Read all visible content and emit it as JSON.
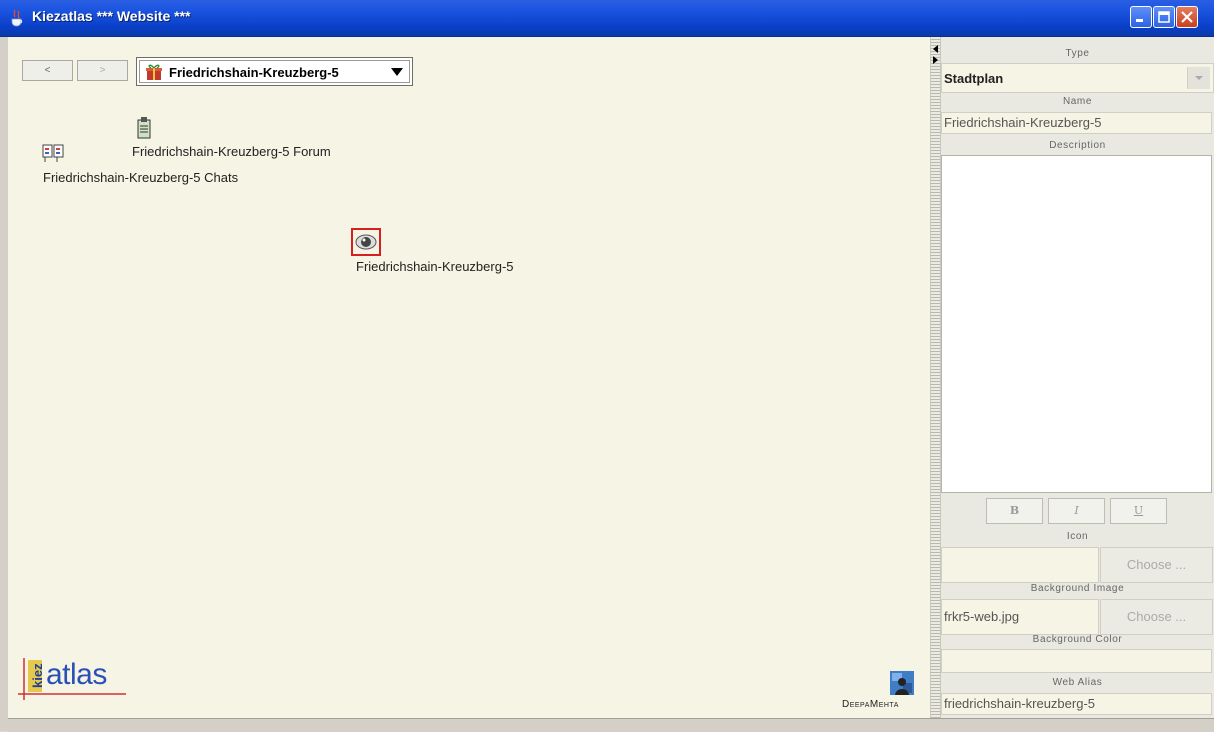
{
  "window": {
    "title": "Kiezatlas *** Website ***"
  },
  "nav": {
    "back_label": "<",
    "forward_label": ">"
  },
  "topicmap": {
    "selected": "Friedrichshain-Kreuzberg-5"
  },
  "nodes": {
    "forum": "Friedrichshain-Kreuzberg-5 Forum",
    "chats": "Friedrichshain-Kreuzberg-5 Chats",
    "map": "Friedrichshain-Kreuzberg-5"
  },
  "logos": {
    "kiezatlas_left": "kiez",
    "kiezatlas_right": "atlas",
    "deepamehta": "DeepaMehta"
  },
  "panel": {
    "type_label": "Type",
    "type_value": "Stadtplan",
    "name_label": "Name",
    "name_value": "Friedrichshain-Kreuzberg-5",
    "description_label": "Description",
    "bold": "B",
    "italic": "I",
    "underline": "U",
    "icon_label": "Icon",
    "icon_value": "",
    "choose_label": "Choose ...",
    "bg_image_label": "Background Image",
    "bg_image_value": "frkr5-web.jpg",
    "bg_color_label": "Background Color",
    "bg_color_value": "",
    "web_alias_label": "Web Alias",
    "web_alias_value": "friedrichshain-kreuzberg-5"
  }
}
